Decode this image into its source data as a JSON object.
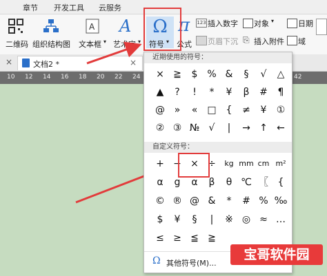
{
  "top_tabs": [
    "章节",
    "开发工具",
    "云服务"
  ],
  "ribbon": {
    "qrcode": "二维码",
    "org_chart": "组织结构图",
    "textbox": "文本框",
    "art_text": "艺术字",
    "symbol": "符号",
    "formula": "公式",
    "insert_number": "插入数字",
    "object": "对象",
    "date": "日期",
    "header_footer": "页眉下沉",
    "insert_attachment": "插入附件",
    "field": "域"
  },
  "doc_tab": {
    "title": "文档2 *"
  },
  "ruler": [
    "10",
    "12",
    "14",
    "16",
    "18",
    "20",
    "22",
    "24",
    "26",
    "28",
    "30",
    "32",
    "34",
    "36",
    "38",
    "40",
    "42"
  ],
  "popup": {
    "recent_header": "近期使用的符号：",
    "recent_rows": [
      [
        "×",
        "≧",
        "$",
        "%",
        "&",
        "§",
        "√",
        "△"
      ],
      [
        "▲",
        "?",
        "!",
        "*",
        "¥",
        "β",
        "#",
        "¶"
      ],
      [
        "@",
        "»",
        "«",
        "□",
        "{",
        "≠",
        "¥",
        "①"
      ],
      [
        "②",
        "③",
        "№",
        "√",
        "|",
        "→",
        "↑",
        "←"
      ]
    ],
    "custom_header": "自定义符号：",
    "custom_rows": [
      [
        "+",
        "−",
        "×",
        "÷",
        "kg",
        "mm",
        "cm",
        "m²"
      ],
      [
        "α",
        "g",
        "α",
        "β",
        "θ",
        "℃",
        "〖",
        "{"
      ],
      [
        "©",
        "®",
        "@",
        "&",
        "*",
        "#",
        "%",
        "‰"
      ],
      [
        "$",
        "¥",
        "§",
        "|",
        "※",
        "◎",
        "≈",
        "…"
      ],
      [
        "≤",
        "≥",
        "≦",
        "≧",
        "",
        "",
        "",
        ""
      ]
    ],
    "more": "其他符号(M)..."
  },
  "watermark": "宝哥软件园",
  "accent_red": "#e23b3b",
  "ribbon_blue": "#2a6fc9"
}
